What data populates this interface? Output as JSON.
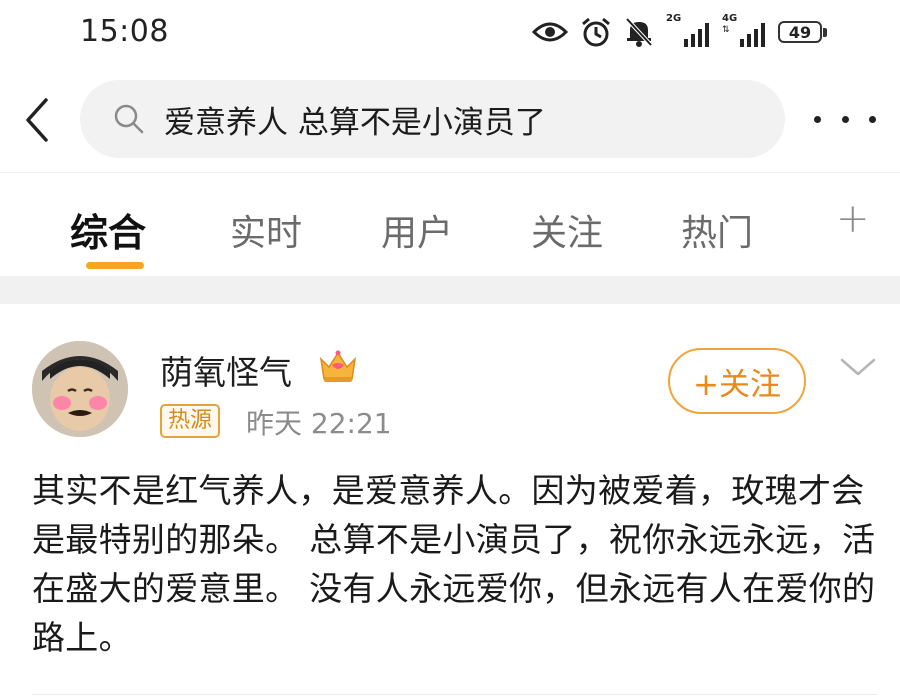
{
  "status_bar": {
    "time": "15:08",
    "signal1_label": "2G",
    "signal2_label": "4G",
    "battery": "49",
    "icons": [
      "eye-icon",
      "alarm-icon",
      "mute-bell-icon",
      "signal-icon",
      "battery-icon"
    ]
  },
  "search": {
    "query": "爱意养人 总算不是小演员了",
    "icon": "search-icon"
  },
  "tabs": [
    {
      "label": "综合",
      "active": true
    },
    {
      "label": "实时",
      "active": false
    },
    {
      "label": "用户",
      "active": false
    },
    {
      "label": "关注",
      "active": false
    },
    {
      "label": "热门",
      "active": false
    }
  ],
  "tab_add_label": "+",
  "post": {
    "username": "荫氧怪气",
    "badge": "热源",
    "time": "昨天 22:21",
    "follow_label": "+关注",
    "body": "其实不是红气养人，是爱意养人。因为被爱着，玫瑰才会是最特别的那朵。 总算不是小演员了，祝你永远永远，活在盛大的爱意里。 没有人永远爱你，但永远有人在爱你的路上。"
  },
  "colors": {
    "accent": "#f6a623",
    "follow": "#e8891a",
    "search_bg": "#f2f2f2"
  }
}
